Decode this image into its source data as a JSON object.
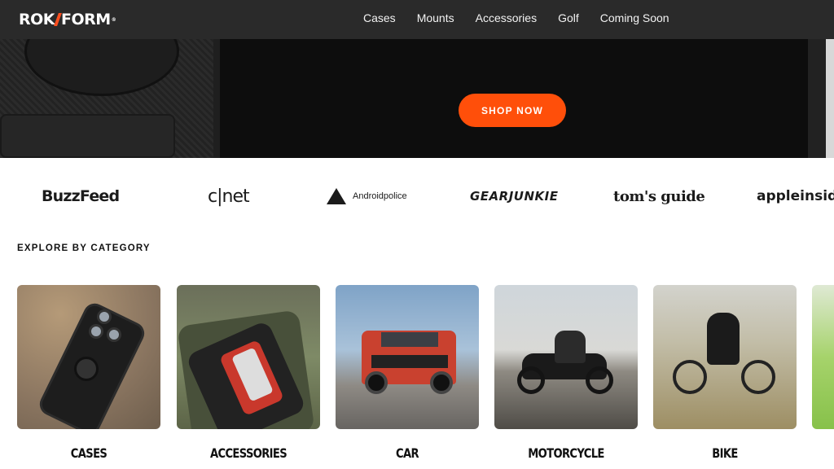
{
  "header": {
    "logo_left": "ROK",
    "logo_right": "FORM",
    "logo_tm": "®",
    "nav": [
      "Cases",
      "Mounts",
      "Accessories",
      "Golf",
      "Coming Soon"
    ]
  },
  "hero": {
    "cta_label": "SHOP NOW",
    "cta_color": "#ff4f0a"
  },
  "press": {
    "logos": [
      "BuzzFeed",
      "c|net",
      "Androidpolice",
      "GEARJUNKIE",
      "tom's guide",
      "appleinside"
    ]
  },
  "explore": {
    "title": "EXPLORE BY CATEGORY",
    "categories": [
      {
        "label": "CASES"
      },
      {
        "label": "ACCESSORIES"
      },
      {
        "label": "CAR"
      },
      {
        "label": "MOTORCYCLE"
      },
      {
        "label": "BIKE"
      }
    ]
  },
  "colors": {
    "header_bg": "#2a2a2a",
    "accent": "#ff4f0a"
  }
}
